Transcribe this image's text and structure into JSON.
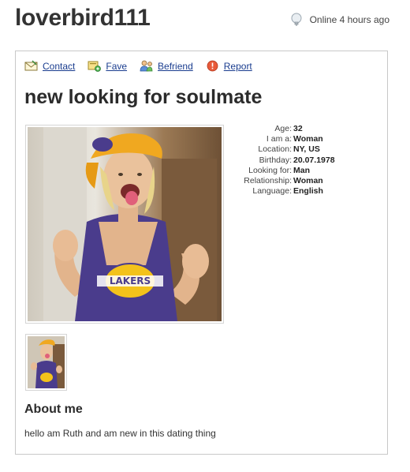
{
  "profile": {
    "username": "loverbird111",
    "status": "Online 4 hours ago",
    "headline": "new looking for soulmate"
  },
  "actions": [
    {
      "label": "Contact",
      "icon": "envelope-icon"
    },
    {
      "label": "Fave",
      "icon": "fave-icon"
    },
    {
      "label": "Befriend",
      "icon": "add-friend-icon"
    },
    {
      "label": "Report",
      "icon": "warning-icon"
    }
  ],
  "details": [
    {
      "label": "Age:",
      "value": "32"
    },
    {
      "label": "I am a:",
      "value": "Woman"
    },
    {
      "label": "Location:",
      "value": "NY, US"
    },
    {
      "label": "Birthday:",
      "value": "20.07.1978"
    },
    {
      "label": "Looking for:",
      "value": "Man"
    },
    {
      "label": "Relationship:",
      "value": "Woman"
    },
    {
      "label": "Language:",
      "value": "English"
    }
  ],
  "about": {
    "heading": "About me",
    "text": "hello am Ruth and am new in this dating thing"
  },
  "colors": {
    "link": "#1a3d8f",
    "border": "#c8c8c8"
  }
}
